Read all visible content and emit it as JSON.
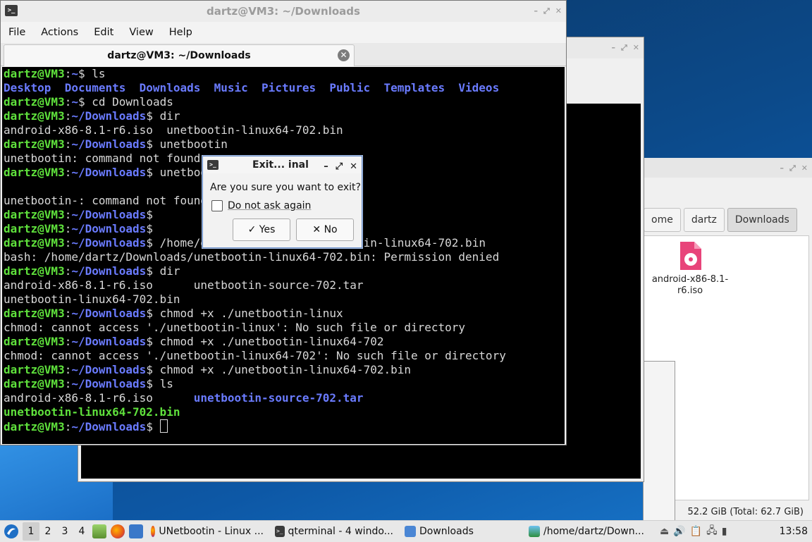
{
  "terminal": {
    "title": "dartz@VM3: ~/Downloads",
    "menu": [
      "File",
      "Actions",
      "Edit",
      "View",
      "Help"
    ],
    "tab_label": "dartz@VM3: ~/Downloads",
    "lines": [
      [
        [
          "u",
          "dartz@VM3"
        ],
        [
          "w",
          ":"
        ],
        [
          "p",
          "~"
        ],
        [
          "w",
          "$ ls"
        ]
      ],
      [
        [
          "d",
          "Desktop  Documents  Downloads  Music  Pictures  Public  Templates  Videos"
        ]
      ],
      [
        [
          "u",
          "dartz@VM3"
        ],
        [
          "w",
          ":"
        ],
        [
          "p",
          "~"
        ],
        [
          "w",
          "$ cd Downloads"
        ]
      ],
      [
        [
          "u",
          "dartz@VM3"
        ],
        [
          "w",
          ":"
        ],
        [
          "p",
          "~/Downloads"
        ],
        [
          "w",
          "$ dir"
        ]
      ],
      [
        [
          "w",
          "android-x86-8.1-r6.iso  unetbootin-linux64-702.bin"
        ]
      ],
      [
        [
          "u",
          "dartz@VM3"
        ],
        [
          "w",
          ":"
        ],
        [
          "p",
          "~/Downloads"
        ],
        [
          "w",
          "$ unetbootin"
        ]
      ],
      [
        [
          "w",
          "unetbootin: command not found"
        ]
      ],
      [
        [
          "u",
          "dartz@VM3"
        ],
        [
          "w",
          ":"
        ],
        [
          "p",
          "~/Downloads"
        ],
        [
          "w",
          "$ unetbootin-"
        ]
      ],
      [
        [
          "w",
          ""
        ]
      ],
      [
        [
          "w",
          "unetbootin-: command not found"
        ]
      ],
      [
        [
          "u",
          "dartz@VM3"
        ],
        [
          "w",
          ":"
        ],
        [
          "p",
          "~/Downloads"
        ],
        [
          "w",
          "$"
        ]
      ],
      [
        [
          "u",
          "dartz@VM3"
        ],
        [
          "w",
          ":"
        ],
        [
          "p",
          "~/Downloads"
        ],
        [
          "w",
          "$"
        ]
      ],
      [
        [
          "u",
          "dartz@VM3"
        ],
        [
          "w",
          ":"
        ],
        [
          "p",
          "~/Downloads"
        ],
        [
          "w",
          "$ /home/dartz/Downloads/unetbootin-linux64-702.bin"
        ]
      ],
      [
        [
          "w",
          "bash: /home/dartz/Downloads/unetbootin-linux64-702.bin: Permission denied"
        ]
      ],
      [
        [
          "u",
          "dartz@VM3"
        ],
        [
          "w",
          ":"
        ],
        [
          "p",
          "~/Downloads"
        ],
        [
          "w",
          "$ dir"
        ]
      ],
      [
        [
          "w",
          "android-x86-8.1-r6.iso      unetbootin-source-702.tar"
        ]
      ],
      [
        [
          "w",
          "unetbootin-linux64-702.bin"
        ]
      ],
      [
        [
          "u",
          "dartz@VM3"
        ],
        [
          "w",
          ":"
        ],
        [
          "p",
          "~/Downloads"
        ],
        [
          "w",
          "$ chmod +x ./unetbootin-linux"
        ]
      ],
      [
        [
          "w",
          "chmod: cannot access './unetbootin-linux': No such file or directory"
        ]
      ],
      [
        [
          "u",
          "dartz@VM3"
        ],
        [
          "w",
          ":"
        ],
        [
          "p",
          "~/Downloads"
        ],
        [
          "w",
          "$ chmod +x ./unetbootin-linux64-702"
        ]
      ],
      [
        [
          "w",
          "chmod: cannot access './unetbootin-linux64-702': No such file or directory"
        ]
      ],
      [
        [
          "u",
          "dartz@VM3"
        ],
        [
          "w",
          ":"
        ],
        [
          "p",
          "~/Downloads"
        ],
        [
          "w",
          "$ chmod +x ./unetbootin-linux64-702.bin"
        ]
      ],
      [
        [
          "u",
          "dartz@VM3"
        ],
        [
          "w",
          ":"
        ],
        [
          "p",
          "~/Downloads"
        ],
        [
          "w",
          "$ ls"
        ]
      ],
      [
        [
          "w",
          "android-x86-8.1-r6.iso      "
        ],
        [
          "d",
          "unetbootin-source-702.tar"
        ]
      ],
      [
        [
          "x",
          "unetbootin-linux64-702.bin"
        ]
      ],
      [
        [
          "u",
          "dartz@VM3"
        ],
        [
          "w",
          ":"
        ],
        [
          "p",
          "~/Downloads"
        ],
        [
          "w",
          "$ "
        ],
        [
          "c",
          ""
        ]
      ]
    ]
  },
  "dialog": {
    "title": "Exit... inal",
    "message": "Are you sure you want to exit?",
    "checkbox_label": "Do not ask again",
    "yes_label": "Yes",
    "no_label": "No"
  },
  "file_manager": {
    "path": [
      "ome",
      "dartz",
      "Downloads"
    ],
    "file_name": "android-x86-8.1-r6.iso",
    "status": "52.2 GiB (Total: 62.7 GiB)"
  },
  "taskbar": {
    "workspaces": [
      "1",
      "2",
      "3",
      "4"
    ],
    "tasks": [
      {
        "label": "UNetbootin - Linux ...",
        "icon": "firefox-icon"
      },
      {
        "label": "qterminal - 4 windo...",
        "icon": "terminal-icon"
      },
      {
        "label": "Downloads",
        "icon": "folder-icon"
      },
      {
        "label": "/home/dartz/Down...",
        "icon": "image-viewer-icon"
      }
    ],
    "clock": "13:58"
  },
  "colors": {
    "prompt_user": "#5fe13c",
    "prompt_path": "#6a7bff",
    "terminal_bg": "#000000",
    "accent": "#4a78c2"
  }
}
